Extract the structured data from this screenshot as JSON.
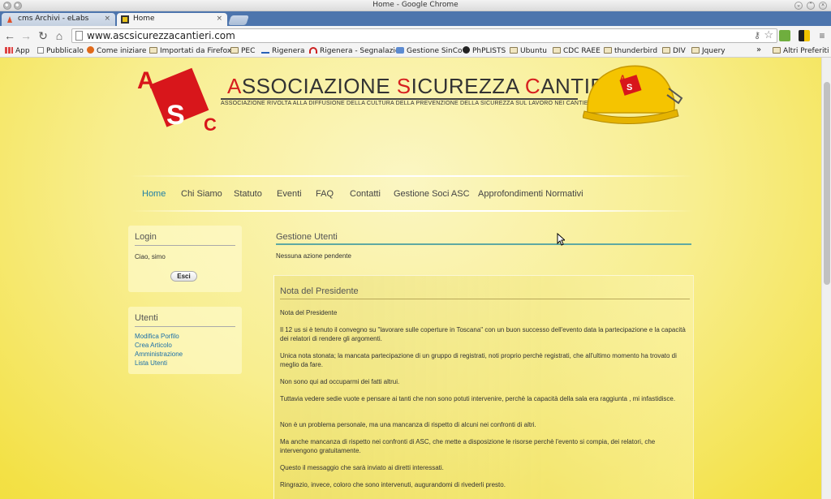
{
  "window": {
    "title": "Home - Google Chrome"
  },
  "tabs": [
    {
      "label": "cms Archivi - eLabs",
      "close": "×"
    },
    {
      "label": "Home",
      "close": "×"
    }
  ],
  "toolbar": {
    "url": "www.ascsicurezzacantieri.com"
  },
  "bookmarks": {
    "items": [
      "App",
      "Pubblicalo",
      "Come iniziare",
      "Importati da Firefox",
      "PEC",
      "Rigenera",
      "Rigenera - Segnalazio",
      "Gestione SinCo",
      "PhPLISTS",
      "Ubuntu",
      "CDC RAEE",
      "thunderbird",
      "DIV",
      "Jquery"
    ],
    "more": "»",
    "other": "Altri Preferiti"
  },
  "header": {
    "logo_letters": {
      "a": "A",
      "s": "S",
      "c": "C"
    },
    "title_parts": [
      "A",
      "SSOCIAZIONE ",
      "S",
      "ICUREZZA ",
      "C",
      "ANTIERI"
    ],
    "tagline": "ASSOCIAZIONE RIVOLTA ALLA DIFFUSIONE DELLA CULTURA DELLA PREVENZIONE DELLA SICUREZZA SUL LAVORO NEI CANTIERI."
  },
  "nav": [
    "Home",
    "Chi Siamo",
    "Statuto",
    "Eventi",
    "FAQ",
    "Contatti",
    "Gestione Soci ASC",
    "Approfondimenti Normativi"
  ],
  "login": {
    "title": "Login",
    "greeting": "Ciao, simo",
    "logout": "Esci"
  },
  "utenti": {
    "title": "Utenti",
    "links": [
      "Modifica Porfilo",
      "Crea Articolo",
      "Amministrazione",
      "Lista Utenti"
    ]
  },
  "gestione": {
    "title": "Gestione Utenti",
    "status": "Nessuna azione pendente"
  },
  "note": {
    "title": "Nota del Presidente",
    "paragraphs": [
      "Nota del Presidente",
      "Il 12 us si è tenuto il convegno su \"lavorare sulle coperture in Toscana\" con un buon successo dell'evento data la partecipazione e la capacità dei relatori di rendere gli argomenti.",
      "Unica nota stonata; la mancata partecipazione di un gruppo di registrati, noti proprio perchè registrati, che all'ultimo momento ha trovato di meglio da fare.",
      "Non sono qui ad occuparmi dei fatti altrui.",
      "Tuttavia vedere sedie vuote e pensare ai tanti che non sono potuti intervenire, perchè la capacità della sala era raggiunta , mi infastidisce.",
      "Non è un problema personale, ma una mancanza di rispetto di alcuni nei confronti di altri.",
      "Ma anche mancanza di rispetto nei confronti di ASC, che mette a disposizione le risorse perchè l'evento si compia, dei relatori, che intervengono gratuitamente.",
      "Questo il messaggio che sarà inviato ai diretti interessati.",
      "Ringrazio, invece, coloro che sono intervenuti, augurandomi di rivederli presto."
    ]
  }
}
